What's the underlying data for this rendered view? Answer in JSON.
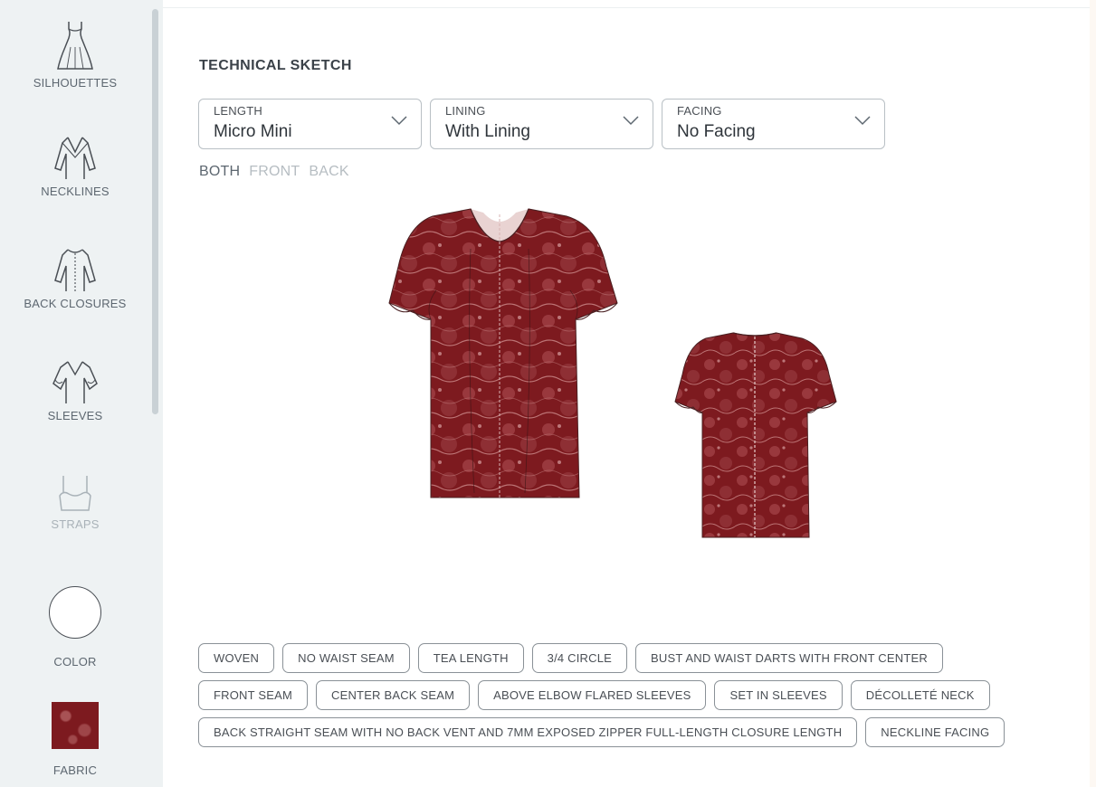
{
  "sidebar": {
    "items": [
      {
        "label": "SILHOUETTES",
        "icon": "dress-silhouette-icon"
      },
      {
        "label": "NECKLINES",
        "icon": "neckline-icon"
      },
      {
        "label": "BACK CLOSURES",
        "icon": "back-closure-icon"
      },
      {
        "label": "SLEEVES",
        "icon": "sleeve-icon"
      },
      {
        "label": "STRAPS",
        "icon": "strap-icon"
      },
      {
        "label": "COLOR",
        "icon": "color-circle-icon"
      },
      {
        "label": "FABRIC",
        "icon": "fabric-swatch-icon"
      }
    ]
  },
  "main": {
    "title": "TECHNICAL SKETCH",
    "dropdowns": [
      {
        "label": "LENGTH",
        "value": "Micro Mini"
      },
      {
        "label": "LINING",
        "value": "With Lining"
      },
      {
        "label": "FACING",
        "value": "No Facing"
      }
    ],
    "view_tabs": [
      "BOTH",
      "FRONT",
      "BACK"
    ],
    "active_view": "BOTH"
  },
  "tags": {
    "row1": [
      "WOVEN",
      "NO WAIST SEAM",
      "TEA LENGTH",
      "3/4 CIRCLE",
      "BUST AND WAIST DARTS WITH FRONT CENTER"
    ],
    "row2": [
      "FRONT SEAM",
      "CENTER BACK SEAM",
      "ABOVE ELBOW FLARED SLEEVES",
      "SET IN SLEEVES",
      "DÉCOLLETÉ NECK"
    ],
    "row3": [
      "BACK STRAIGHT SEAM WITH NO BACK VENT AND 7MM EXPOSED ZIPPER FULL-LENGTH CLOSURE LENGTH",
      "NECKLINE FACING"
    ]
  },
  "colors": {
    "fabric": "#7d1a1f",
    "lace_highlight": "#d89a9a",
    "sidebar_bg": "#eef2f3",
    "page_bg": "#fdf8f3"
  }
}
